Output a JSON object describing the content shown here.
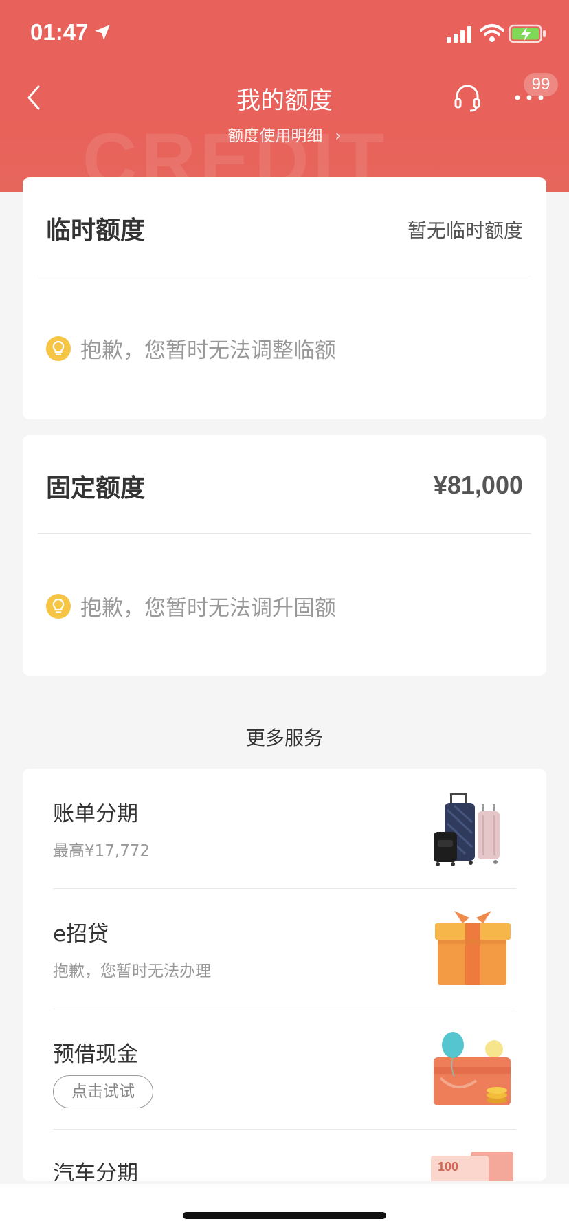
{
  "status_bar": {
    "time": "01:47"
  },
  "nav": {
    "title": "我的额度",
    "badge": "99"
  },
  "usage_link": {
    "label": "额度使用明细",
    "chevron": "›"
  },
  "temp_quota": {
    "title": "临时额度",
    "status": "暂无临时额度",
    "tip": "抱歉，您暂时无法调整临额"
  },
  "fixed_quota": {
    "title": "固定额度",
    "amount": "¥81,000",
    "tip": "抱歉，您暂时无法调升固额"
  },
  "more_services": {
    "title": "更多服务",
    "items": [
      {
        "title": "账单分期",
        "subtitle": "最高¥17,772",
        "icon": "luggage-icon"
      },
      {
        "title": "e招贷",
        "subtitle": "抱歉，您暂时无法办理",
        "icon": "gift-box-icon"
      },
      {
        "title": "预借现金",
        "button": "点击试试",
        "icon": "cash-card-icon"
      },
      {
        "title": "汽车分期",
        "icon": "banknote-icon"
      }
    ]
  },
  "colors": {
    "header": "#e8615a",
    "bulb": "#f6c544",
    "background": "#f5f5f5"
  }
}
